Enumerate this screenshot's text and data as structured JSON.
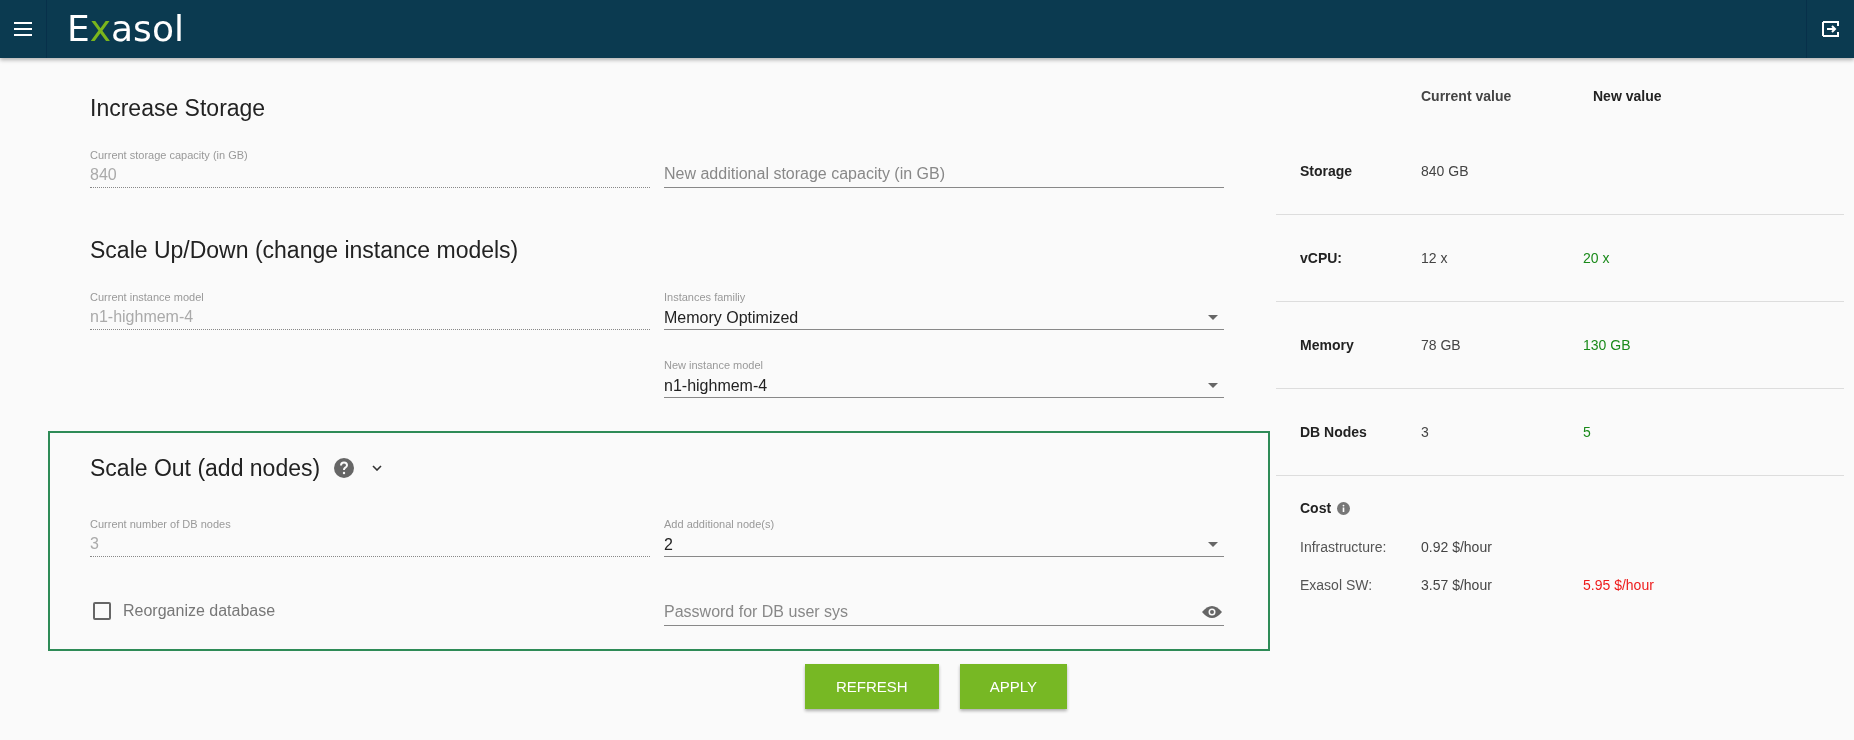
{
  "header": {
    "logo": [
      {
        "text": "E",
        "accent": false
      },
      {
        "text": "x",
        "accent": true
      },
      {
        "text": "asol",
        "accent": false
      }
    ]
  },
  "sections": [
    {
      "title": "Increase Storage",
      "help": false,
      "collapsible": false,
      "highlighted": false,
      "rows": [
        {
          "left": {
            "kind": "readonly",
            "label": "Current storage capacity (in GB)",
            "value": "840"
          },
          "right": {
            "kind": "input",
            "placeholder": "New additional storage capacity (in GB)"
          }
        }
      ]
    },
    {
      "title": "Scale Up/Down (change instance models)",
      "help": false,
      "collapsible": false,
      "highlighted": false,
      "rows": [
        {
          "left": {
            "kind": "readonly",
            "label": "Current instance model",
            "value": "n1-highmem-4"
          },
          "right": {
            "kind": "select",
            "label": "Instances familiy",
            "value": "Memory Optimized"
          }
        },
        {
          "right": {
            "kind": "select",
            "label": "New instance model",
            "value": "n1-highmem-4"
          }
        }
      ]
    },
    {
      "title": "Scale Out (add nodes)",
      "help": true,
      "collapsible": true,
      "highlighted": true,
      "rows": [
        {
          "left": {
            "kind": "readonly",
            "label": "Current number of DB nodes",
            "value": "3"
          },
          "right": {
            "kind": "select",
            "label": "Add additional node(s)",
            "value": "2"
          }
        },
        {
          "left": {
            "kind": "checkbox",
            "label": "Reorganize database",
            "checked": false
          },
          "right": {
            "kind": "password",
            "placeholder": "Password for DB user sys"
          }
        }
      ]
    }
  ],
  "buttons": [
    "REFRESH",
    "APPLY"
  ],
  "summary": {
    "columns": [
      "Current value",
      "New value"
    ],
    "rows": [
      {
        "label": "Storage",
        "current": "840 GB"
      },
      {
        "label": "vCPU:",
        "current": "12 x",
        "new": "20 x",
        "color": "#1a8a1a"
      },
      {
        "label": "Memory",
        "current": "78 GB",
        "new": "130 GB",
        "color": "#1a8a1a"
      },
      {
        "label": "DB Nodes",
        "current": "3",
        "new": "5",
        "color": "#1a8a1a"
      }
    ],
    "cost": {
      "title": "Cost",
      "rows": [
        {
          "label": "Infrastructure:",
          "current": "0.92 $/hour"
        },
        {
          "label": "Exasol SW:",
          "current": "3.57 $/hour",
          "new": "5.95 $/hour",
          "color": "#ee1c1c"
        }
      ]
    }
  }
}
